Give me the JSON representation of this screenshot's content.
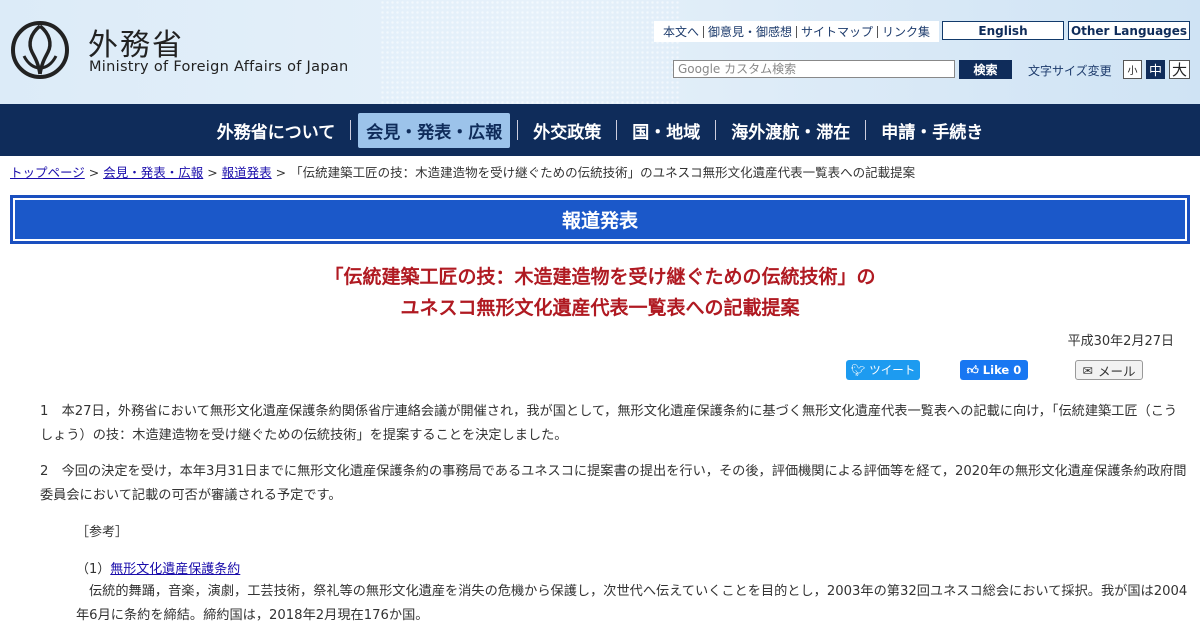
{
  "header": {
    "site_name_ja": "外務省",
    "site_name_en": "Ministry of Foreign Affairs of Japan",
    "util_links": [
      "本文へ",
      "御意見・御感想",
      "サイトマップ",
      "リンク集"
    ],
    "lang_english": "English",
    "lang_other": "Other Languages",
    "search_placeholder": "Google カスタム検索",
    "search_button": "検索",
    "font_size_label": "文字サイズ変更",
    "font_small": "小",
    "font_medium": "中",
    "font_large": "大"
  },
  "nav": {
    "items": [
      "外務省について",
      "会見・発表・広報",
      "外交政策",
      "国・地域",
      "海外渡航・滞在",
      "申請・手続き"
    ],
    "active_index": 1
  },
  "breadcrumb": {
    "links": [
      "トップページ",
      "会見・発表・広報",
      "報道発表"
    ],
    "current": "「伝統建築工匠の技：木造建造物を受け継ぐための伝統技術」のユネスコ無形文化遺産代表一覧表への記載提案"
  },
  "section": {
    "title": "報道発表"
  },
  "article": {
    "title_line1": "「伝統建築工匠の技：木造建造物を受け継ぐための伝統技術」の",
    "title_line2": "ユネスコ無形文化遺産代表一覧表への記載提案",
    "date": "平成30年2月27日",
    "share_tweet": "ツイート",
    "share_like": "Like 0",
    "share_mail": "メール",
    "paragraph1": "1　本27日，外務省において無形文化遺産保護条約関係省庁連絡会議が開催され，我が国として，無形文化遺産保護条約に基づく無形文化遺産代表一覧表への記載に向け，「伝統建築工匠（こうしょう）の技：木造建造物を受け継ぐための伝統技術」を提案することを決定しました。",
    "paragraph2": "2　今回の決定を受け，本年3月31日までに無形文化遺産保護条約の事務局であるユネスコに提案書の提出を行い，その後，評価機関による評価等を経て，2020年の無形文化遺産保護条約政府間委員会において記載の可否が審議される予定です。",
    "reference_heading": "［参考］",
    "ref1_prefix": "（1）",
    "ref1_link": "無形文化遺産保護条約",
    "ref1_desc": "伝統的舞踊，音楽，演劇，工芸技術，祭礼等の無形文化遺産を消失の危機から保護し，次世代へ伝えていくことを目的とし，2003年の第32回ユネスコ総会において採択。我が国は2004年6月に条約を締結。締約国は，2018年2月現在176か国。"
  },
  "colors": {
    "navy": "#0f2c5a",
    "banner_blue": "#1b58c9",
    "title_red": "#b01a22",
    "nav_active": "#9cc3ea"
  }
}
